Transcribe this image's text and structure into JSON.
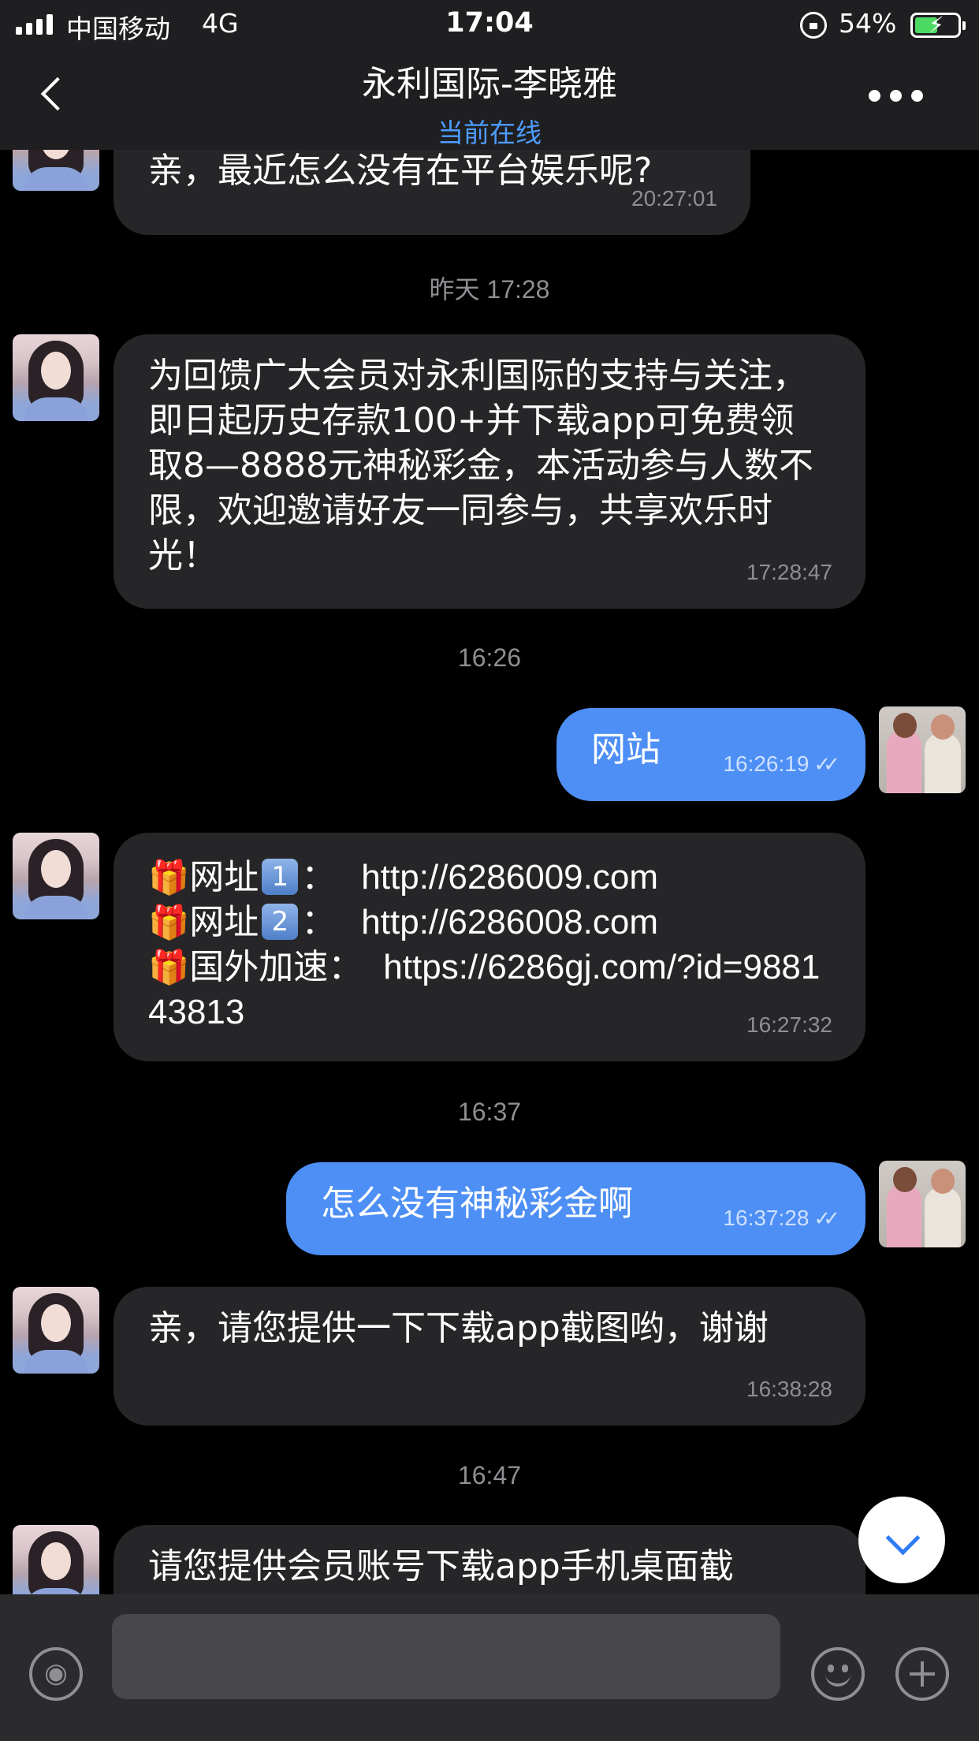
{
  "status_bar": {
    "carrier": "中国移动",
    "network": "4G",
    "time": "17:04",
    "battery_percent": "54%",
    "battery_level": 0.54,
    "battery_color": "#4cd964"
  },
  "header": {
    "title": "永利国际-李晓雅",
    "subtitle": "当前在线",
    "back_icon": "chevron-left-icon",
    "more_icon": "ellipsis-icon"
  },
  "messages": {
    "m0": {
      "text": "亲，最近怎么没有在平台娱乐呢?",
      "time": "20:27:01"
    },
    "sep1": "昨天 17:28",
    "m1": {
      "text": "为回馈广大会员对永利国际的支持与关注，即日起历史存款100+并下载app可免费领取8—8888元神秘彩金，本活动参与人数不限，欢迎邀请好友一同参与，共享欢乐时光！",
      "time": "17:28:47"
    },
    "sep2": "16:26",
    "m2": {
      "text": "网站",
      "time": "16:26:19",
      "status_icon": "double-check-icon"
    },
    "m3": {
      "line1_label": "网址",
      "line1_num": "1",
      "line1_url": "http://6286009.com",
      "line2_label": "网址",
      "line2_num": "2",
      "line2_url": "http://6286008.com",
      "line3_label": "国外加速：",
      "line3_url": "https://6286gj.com/?id=988143813",
      "time": "16:27:32",
      "bullet_icon": "gift-icon"
    },
    "sep3": "16:37",
    "m4": {
      "text": "怎么没有神秘彩金啊",
      "time": "16:37:28",
      "status_icon": "double-check-icon"
    },
    "m5": {
      "text": "亲，请您提供一下下载app截图哟，谢谢",
      "time": "16:38:28"
    },
    "sep4": "16:47",
    "m6": {
      "text": "请您提供会员账号下载app手机桌面截"
    }
  },
  "colors": {
    "background": "#000000",
    "incoming_bubble": "#262628",
    "outgoing_bubble": "#4d8ff5",
    "accent": "#4e9cff"
  },
  "input_bar": {
    "placeholder": "",
    "voice_icon": "voice-icon",
    "emoji_icon": "emoji-icon",
    "plus_icon": "plus-icon"
  },
  "scroll_icon": "chevron-down-icon"
}
